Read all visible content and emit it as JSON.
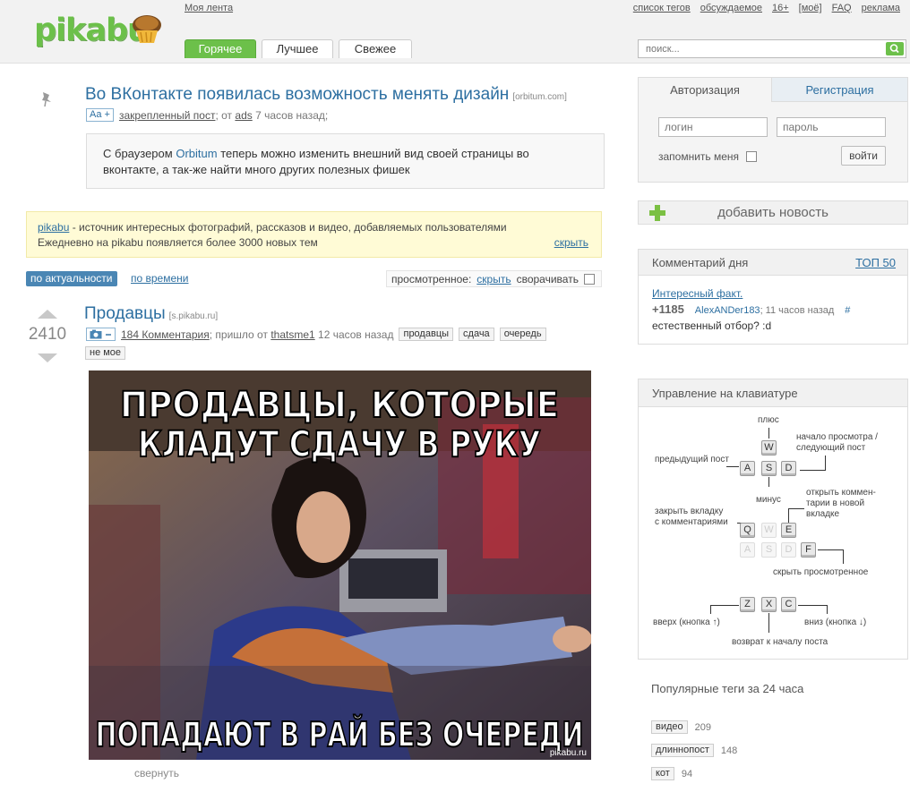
{
  "header": {
    "logo_text": "pikabu",
    "my_feed": "Моя лента",
    "top_links": [
      "список тегов",
      "обсуждаемое",
      "16+",
      "[моё]",
      "FAQ",
      "реклама"
    ],
    "tabs": [
      "Горячее",
      "Лучшее",
      "Свежее"
    ],
    "active_tab": "Горячее",
    "search_placeholder": "поиск..."
  },
  "pinned": {
    "title": "Во ВКонтакте появилась возможность менять дизайн",
    "source": "[orbitum.com]",
    "aa_badge": "Aa +",
    "pinned_label": "закрепленный пост",
    "from": "; от",
    "author": "ads",
    "time": "7 часов назад;",
    "text_before": "С браузером",
    "text_highlight": "Orbitum",
    "text_after": "теперь можно изменить внешний вид своей страницы во вконтакте, а так-же найти много других полезных фишек"
  },
  "info": {
    "site": "pikabu",
    "line1": "- источник интересных фотографий, рассказов и видео, добавляемых пользователями",
    "line2": "Ежедневно на pikabu появляется более 3000 новых тем",
    "hide": "скрыть"
  },
  "sort": {
    "actual": "по актуальности",
    "time": "по времени",
    "viewed_label": "просмотренное:",
    "viewed_hide": "скрыть",
    "collapse_label": "сворачивать"
  },
  "post": {
    "score": "2410",
    "title": "Продавцы",
    "source": "[s.pikabu.ru]",
    "comments": "184 Комментария",
    "sent_from": "; пришло от",
    "author": "thatsme1",
    "time": "12 часов назад",
    "tags": [
      "продавцы",
      "сдача",
      "очередь"
    ],
    "not_mine": "не мое",
    "image_top_line1": "ПРОДАВЦЫ, КОТОРЫЕ",
    "image_top_line2": "КЛАДУТ СДАЧУ В РУКУ",
    "image_bottom": "ПОПАДАЮТ В РАЙ БЕЗ ОЧЕРЕДИ",
    "watermark": "pikabu.ru",
    "collapse": "свернуть"
  },
  "auth": {
    "tab_login": "Авторизация",
    "tab_register": "Регистрация",
    "login_placeholder": "логин",
    "password_placeholder": "пароль",
    "remember": "запомнить меня",
    "login_button": "войти"
  },
  "add_news": "добавить новость",
  "comment_of_day": {
    "title": "Комментарий дня",
    "top": "ТОП 50",
    "post_link": "Интересный факт.",
    "score": "+1185",
    "author": "AlexANDer183",
    "time": "; 11 часов назад",
    "hash": "#",
    "text": "естественный отбор? :d"
  },
  "keyboard": {
    "title": "Управление на клавиатуре",
    "plus": "плюс",
    "start_view": "начало просмотра /",
    "next_post": "следующий пост",
    "prev_post": "предыдущий пост",
    "minus": "минус",
    "open_comments_1": "открыть коммен-",
    "open_comments_2": "тарии в новой",
    "open_comments_3": "вкладке",
    "close_tab_1": "закрыть вкладку",
    "close_tab_2": "с комментариями",
    "hide_viewed": "скрыть просмотренное",
    "up": "вверх (кнопка ↑)",
    "down": "вниз (кнопка ↓)",
    "back_to_start": "возврат к началу поста",
    "keys_row1": [
      "W"
    ],
    "keys_row2": [
      "A",
      "S",
      "D"
    ],
    "keys_row3": [
      "Q",
      "W",
      "E"
    ],
    "keys_row4": [
      "A",
      "S",
      "D",
      "F"
    ],
    "keys_row5": [
      "Z",
      "X",
      "C"
    ]
  },
  "popular_tags": {
    "title": "Популярные теги за 24 часа",
    "items": [
      {
        "tag": "видео",
        "count": "209"
      },
      {
        "tag": "длиннопост",
        "count": "148"
      },
      {
        "tag": "кот",
        "count": "94"
      }
    ]
  },
  "colors": {
    "brand_green": "#6cc04a",
    "link_blue": "#2d6fa1",
    "banner_yellow": "#fffbd6"
  }
}
